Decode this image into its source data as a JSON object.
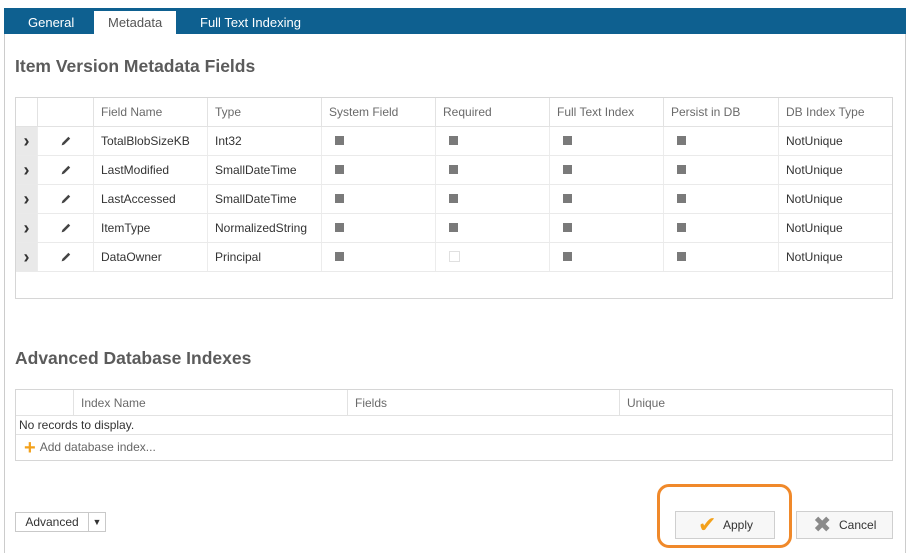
{
  "tabs": [
    {
      "label": "General"
    },
    {
      "label": "Metadata"
    },
    {
      "label": "Full Text Indexing"
    }
  ],
  "metadata": {
    "title": "Item Version Metadata Fields",
    "columns": [
      "Field Name",
      "Type",
      "System Field",
      "Required",
      "Full Text Index",
      "Persist in DB",
      "DB Index Type"
    ],
    "rows": [
      {
        "name": "TotalBlobSizeKB",
        "type": "Int32",
        "system": true,
        "required": true,
        "fulltext": true,
        "persist": true,
        "index": "NotUnique"
      },
      {
        "name": "LastModified",
        "type": "SmallDateTime",
        "system": true,
        "required": true,
        "fulltext": true,
        "persist": true,
        "index": "NotUnique"
      },
      {
        "name": "LastAccessed",
        "type": "SmallDateTime",
        "system": true,
        "required": true,
        "fulltext": true,
        "persist": true,
        "index": "NotUnique"
      },
      {
        "name": "ItemType",
        "type": "NormalizedString",
        "system": true,
        "required": true,
        "fulltext": true,
        "persist": true,
        "index": "NotUnique"
      },
      {
        "name": "DataOwner",
        "type": "Principal",
        "system": true,
        "required": false,
        "fulltext": true,
        "persist": true,
        "index": "NotUnique"
      }
    ]
  },
  "indexes": {
    "title": "Advanced Database Indexes",
    "columns": [
      "Index Name",
      "Fields",
      "Unique"
    ],
    "empty_text": "No records to display.",
    "add_label": "Add database index..."
  },
  "footer": {
    "advanced_label": "Advanced",
    "apply_label": "Apply",
    "cancel_label": "Cancel"
  },
  "colors": {
    "tabstrip": "#0e6090",
    "accent": "#f3a11b",
    "highlight": "#f0892a"
  }
}
